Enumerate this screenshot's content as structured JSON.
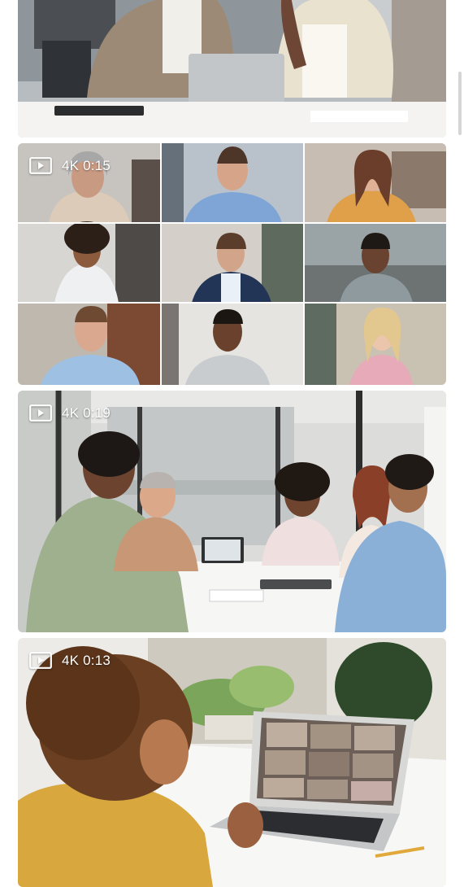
{
  "videos": [
    {
      "badge": ""
    },
    {
      "badge": "4K 0:15"
    },
    {
      "badge": "4K 0:19"
    },
    {
      "badge": "4K 0:13"
    }
  ],
  "colors": {
    "badge_text": "#ffffff",
    "page_background": "#ffffff"
  },
  "icons": {
    "video": "play-icon"
  }
}
